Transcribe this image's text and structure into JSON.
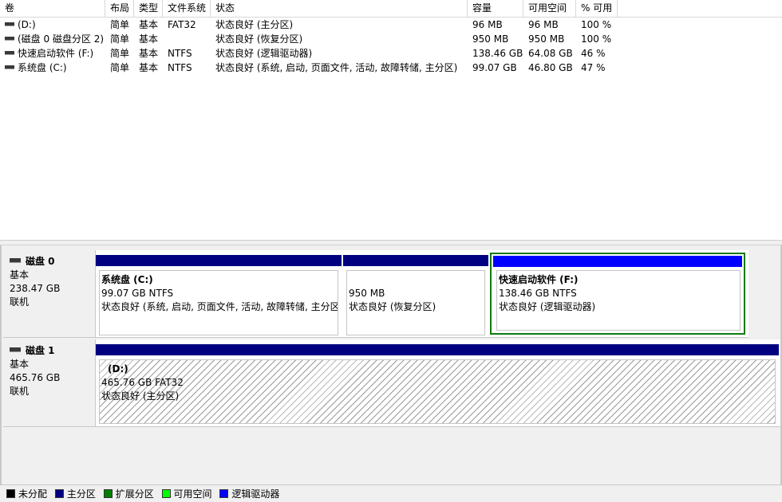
{
  "columns": [
    "卷",
    "布局",
    "类型",
    "文件系统",
    "状态",
    "容量",
    "可用空间",
    "% 可用"
  ],
  "volumes": [
    {
      "name": "(D:)",
      "layout": "简单",
      "type": "基本",
      "fs": "FAT32",
      "status": "状态良好 (主分区)",
      "capacity": "96 MB",
      "free": "96 MB",
      "pct": "100 %"
    },
    {
      "name": "(磁盘 0 磁盘分区 2)",
      "layout": "简单",
      "type": "基本",
      "fs": "",
      "status": "状态良好 (恢复分区)",
      "capacity": "950 MB",
      "free": "950 MB",
      "pct": "100 %"
    },
    {
      "name": "快速启动软件 (F:)",
      "layout": "简单",
      "type": "基本",
      "fs": "NTFS",
      "status": "状态良好 (逻辑驱动器)",
      "capacity": "138.46 GB",
      "free": "64.08 GB",
      "pct": "46 %"
    },
    {
      "name": "系统盘 (C:)",
      "layout": "简单",
      "type": "基本",
      "fs": "NTFS",
      "status": "状态良好 (系统, 启动, 页面文件, 活动, 故障转储, 主分区)",
      "capacity": "99.07 GB",
      "free": "46.80 GB",
      "pct": "47 %"
    }
  ],
  "disks": [
    {
      "name": "磁盘 0",
      "type": "基本",
      "size": "238.47 GB",
      "state": "联机",
      "partitions": [
        {
          "name": "系统盘  (C:)",
          "size": "99.07 GB NTFS",
          "status": "状态良好 (系统, 启动, 页面文件, 活动, 故障转储, 主分区"
        },
        {
          "name": "",
          "size": "950 MB",
          "status": "状态良好 (恢复分区)"
        },
        {
          "name": "快速启动软件  (F:)",
          "size": "138.46 GB NTFS",
          "status": "状态良好 (逻辑驱动器)"
        }
      ]
    },
    {
      "name": "磁盘 1",
      "type": "基本",
      "size": "465.76 GB",
      "state": "联机",
      "partitions": [
        {
          "name": "(D:)",
          "size": "465.76 GB FAT32",
          "status": "状态良好 (主分区)"
        }
      ]
    }
  ],
  "legend": [
    {
      "label": "未分配",
      "color": "#000000"
    },
    {
      "label": "主分区",
      "color": "#000080"
    },
    {
      "label": "扩展分区",
      "color": "#008000"
    },
    {
      "label": "可用空间",
      "color": "#00ff00"
    },
    {
      "label": "逻辑驱动器",
      "color": "#0000ff"
    }
  ],
  "colors": {
    "primary": "#000080",
    "logical": "#0000ff",
    "selected_border": "#117a11"
  }
}
